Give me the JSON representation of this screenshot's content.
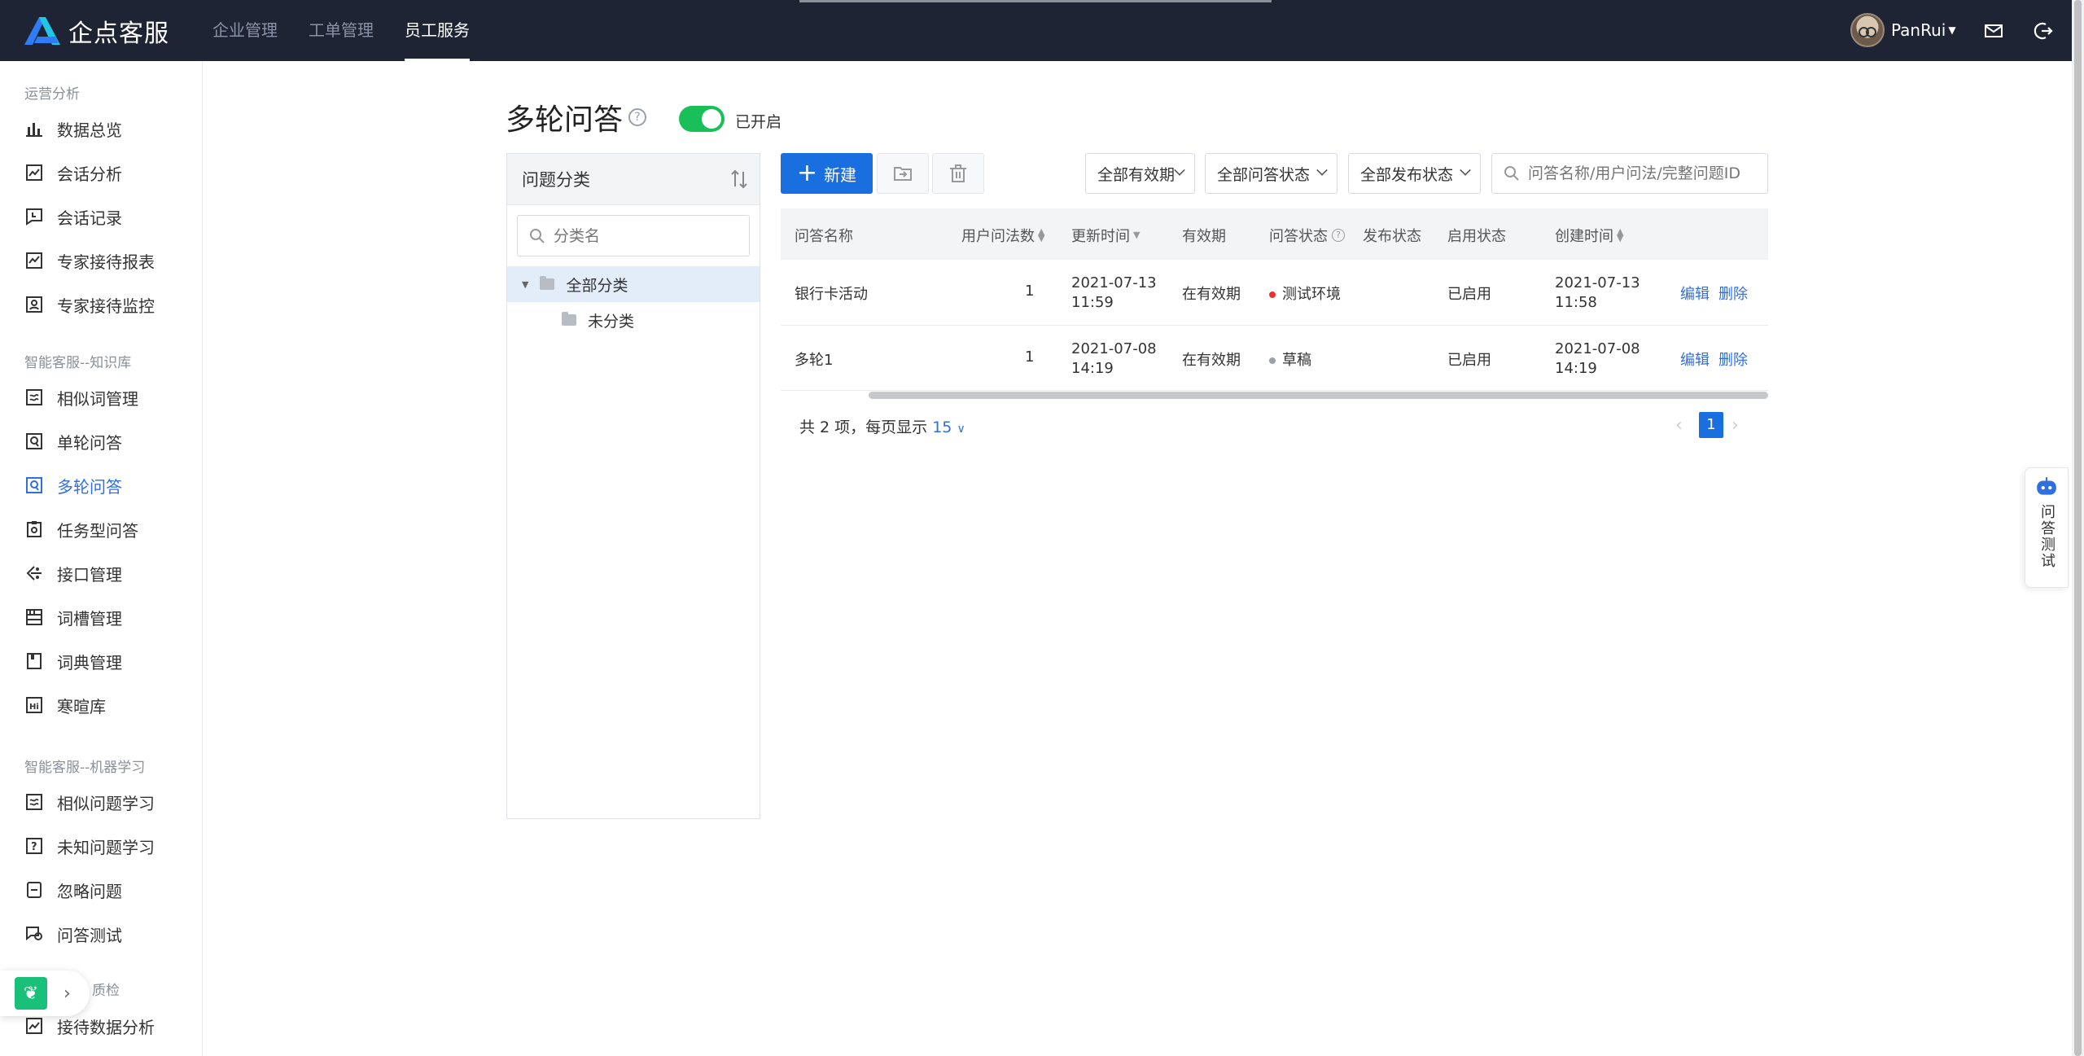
{
  "app": {
    "logo_text": "企点客服",
    "nav": [
      "企业管理",
      "工单管理",
      "员工服务"
    ],
    "active_nav": "员工服务",
    "user_name": "PanRui"
  },
  "sidebar": {
    "groups": [
      {
        "title": "运营分析",
        "items": [
          {
            "label": "数据总览",
            "icon": "bar-chart-icon"
          },
          {
            "label": "会话分析",
            "icon": "trend-chart-icon"
          },
          {
            "label": "会话记录",
            "icon": "chat-record-icon"
          },
          {
            "label": "专家接待报表",
            "icon": "report-icon"
          },
          {
            "label": "专家接待监控",
            "icon": "monitor-icon"
          }
        ]
      },
      {
        "title": "智能客服--知识库",
        "items": [
          {
            "label": "相似词管理",
            "icon": "similar-words-icon"
          },
          {
            "label": "单轮问答",
            "icon": "single-qa-icon"
          },
          {
            "label": "多轮问答",
            "icon": "multi-qa-icon",
            "active": true
          },
          {
            "label": "任务型问答",
            "icon": "task-qa-icon"
          },
          {
            "label": "接口管理",
            "icon": "api-icon"
          },
          {
            "label": "词槽管理",
            "icon": "slot-icon"
          },
          {
            "label": "词典管理",
            "icon": "dictionary-icon"
          },
          {
            "label": "寒暄库",
            "icon": "greeting-icon"
          }
        ]
      },
      {
        "title": "智能客服--机器学习",
        "items": [
          {
            "label": "相似问题学习",
            "icon": "similar-question-icon"
          },
          {
            "label": "未知问题学习",
            "icon": "unknown-question-icon"
          },
          {
            "label": "忽略问题",
            "icon": "ignore-icon"
          },
          {
            "label": "问答测试",
            "icon": "qa-test-icon"
          }
        ]
      },
      {
        "title": "质检",
        "items": [
          {
            "label": "接待数据分析",
            "icon": "analysis-icon"
          }
        ]
      }
    ]
  },
  "page": {
    "title": "多轮问答",
    "toggle_label": "已开启",
    "toggle_on": true
  },
  "category": {
    "header": "问题分类",
    "search_placeholder": "分类名",
    "nodes": [
      {
        "label": "全部分类",
        "selected": true
      },
      {
        "label": "未分类"
      }
    ]
  },
  "toolbar": {
    "new_label": "新建",
    "filters": [
      "全部有效期",
      "全部问答状态",
      "全部发布状态"
    ],
    "search_placeholder": "问答名称/用户问法/完整问题ID"
  },
  "table": {
    "columns": [
      "问答名称",
      "用户问法数",
      "更新时间",
      "有效期",
      "问答状态",
      "发布状态",
      "启用状态",
      "创建时间"
    ],
    "rows": [
      {
        "name": "银行卡活动",
        "count": "1",
        "updated_date": "2021-07-13",
        "updated_time": "11:59",
        "validity": "在有效期",
        "status": "测试环境",
        "status_color": "#e8322f",
        "publish": "",
        "enabled": "已启用",
        "created_date": "2021-07-13",
        "created_time": "11:58",
        "edit": "编辑",
        "delete": "删除"
      },
      {
        "name": "多轮1",
        "count": "1",
        "updated_date": "2021-07-08",
        "updated_time": "14:19",
        "validity": "在有效期",
        "status": "草稿",
        "status_color": "#9aa0aa",
        "publish": "",
        "enabled": "已启用",
        "created_date": "2021-07-08",
        "created_time": "14:19",
        "edit": "编辑",
        "delete": "删除"
      }
    ]
  },
  "pagination": {
    "total_text": "共 2 项，每页显示",
    "page_size": "15",
    "current_page": "1"
  },
  "widget": {
    "label": "问答测试"
  }
}
